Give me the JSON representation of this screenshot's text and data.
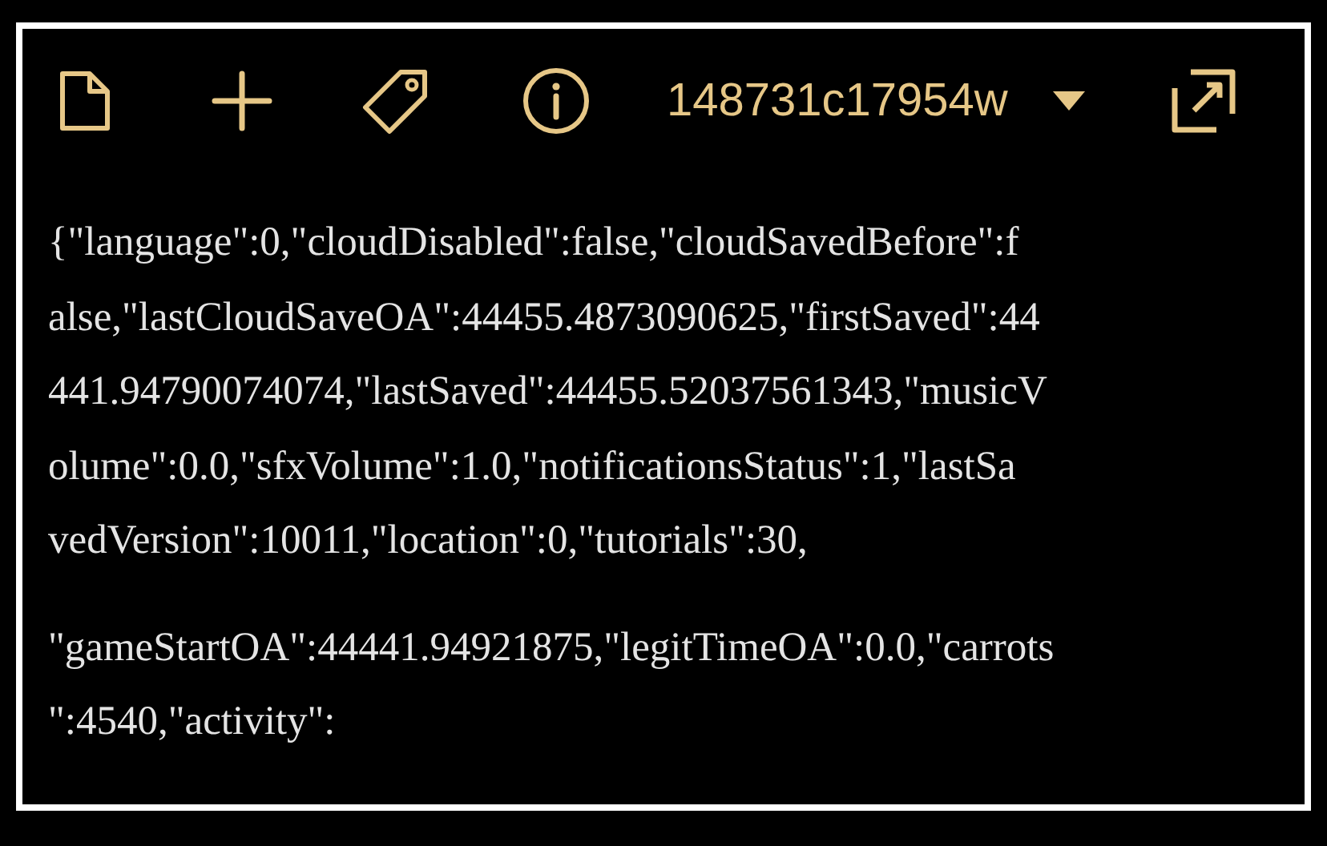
{
  "toolbar": {
    "title": "148731c17954w"
  },
  "paragraphs": [
    {
      "lines": [
        "{\"language\":0,\"cloudDisabled\":false,\"cloudSavedBefore\":f",
        "alse,\"lastCloudSaveOA\":44455.4873090625,\"firstSaved\":44",
        "441.94790074074,\"lastSaved\":44455.52037561343,\"musicV",
        "olume\":0.0,\"sfxVolume\":1.0,\"notificationsStatus\":1,\"lastSa",
        "vedVersion\":10011,\"location\":0,\"tutorials\":30,"
      ]
    },
    {
      "lines": [
        "\"gameStartOA\":44441.94921875,\"legitTimeOA\":0.0,\"carrots",
        "\":4540,\"activity\":"
      ]
    }
  ]
}
